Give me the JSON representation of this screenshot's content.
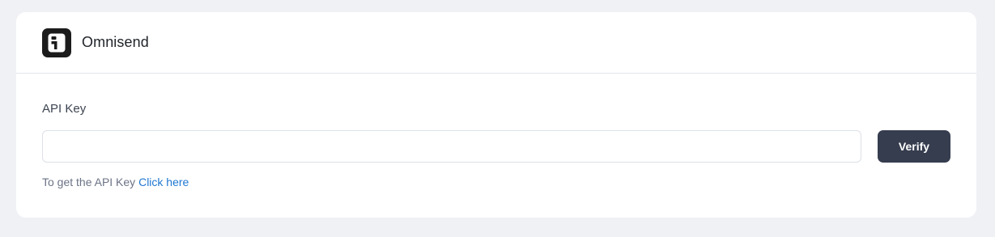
{
  "header": {
    "app_name": "Omnisend",
    "logo_icon": "omnisend-logo-icon"
  },
  "form": {
    "api_key_label": "API Key",
    "api_key_value": "",
    "api_key_placeholder": "",
    "verify_label": "Verify",
    "help_prefix": "To get the API Key",
    "help_link_label": "Click here"
  },
  "colors": {
    "background": "#f0f1f5",
    "button": "#363d4f",
    "link": "#1f78d1"
  }
}
